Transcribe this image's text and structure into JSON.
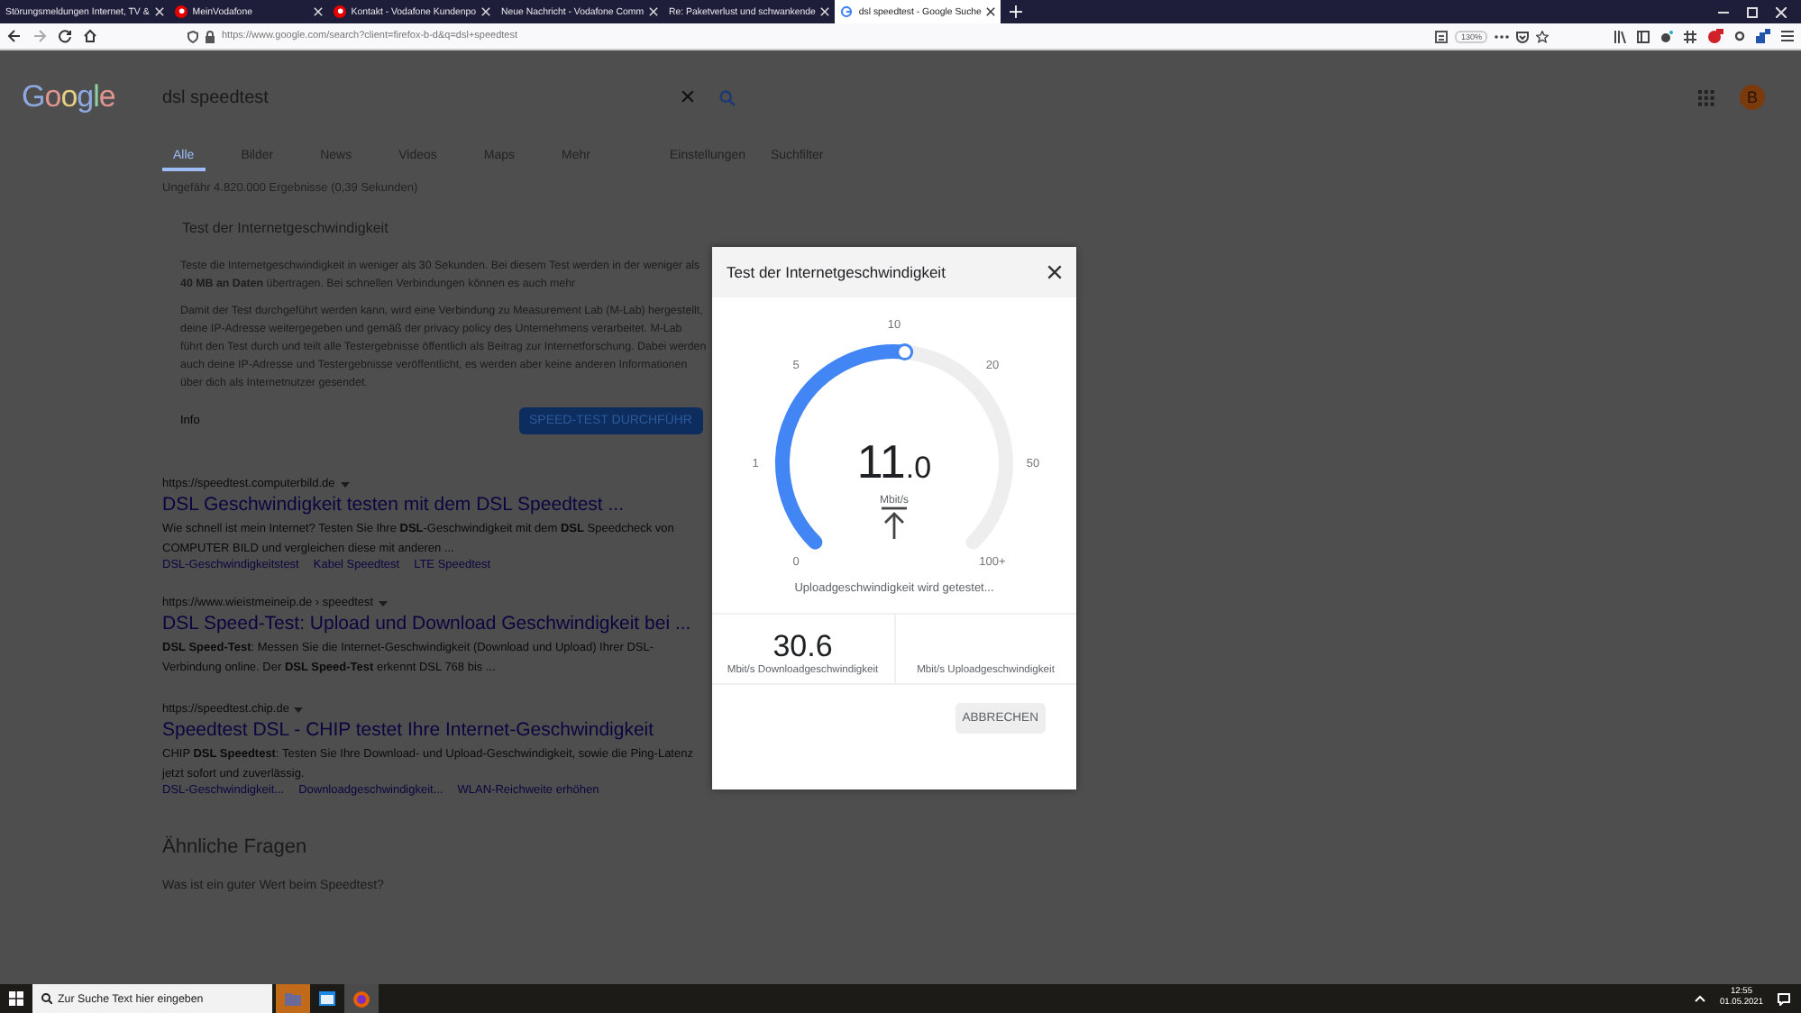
{
  "browser": {
    "tabs": [
      {
        "title": "Störungsmeldungen Internet, TV &",
        "kind": "plain",
        "selected": false
      },
      {
        "title": "MeinVodafone",
        "kind": "vodafone",
        "selected": false
      },
      {
        "title": "Kontakt - Vodafone Kundenpo",
        "kind": "vodafone",
        "selected": false
      },
      {
        "title": "Neue Nachricht - Vodafone Comm",
        "kind": "plain",
        "selected": false
      },
      {
        "title": "Re: Paketverlust und schwankende",
        "kind": "plain",
        "selected": false
      },
      {
        "title": "dsl speedtest - Google Suche",
        "kind": "google",
        "selected": true
      }
    ],
    "url": "https://www.google.com/search?client=firefox-b-d&q=dsl+speedtest",
    "zoom": "130%"
  },
  "google": {
    "logo": "Google",
    "query": "dsl speedtest",
    "avatar": "B",
    "nav": [
      {
        "label": "Alle",
        "selected": true
      },
      {
        "label": "Bilder",
        "selected": false
      },
      {
        "label": "News",
        "selected": false
      },
      {
        "label": "Videos",
        "selected": false
      },
      {
        "label": "Maps",
        "selected": false
      },
      {
        "label": "Mehr",
        "selected": false
      }
    ],
    "tools": [
      "Einstellungen",
      "Suchfilter"
    ],
    "result_count": "Ungefähr 4.820.000 Ergebnisse (0,39 Sekunden)",
    "speed_card": {
      "title": "Test der Internetgeschwindigkeit",
      "paragraphs": [
        "Teste die Internetgeschwindigkeit in weniger als 30 Sekunden. Bei diesem Test werden in der weniger als **40 MB an Daten** übertragen. Bei schnellen Verbindungen können es auch mehr",
        "Damit der Test durchgeführt werden kann, wird eine Verbindung zu Measurement Lab (M-Lab) hergestellt, deine IP-Adresse weitergegeben und gemäß der privacy policy des Unternehmens verarbeitet. M-Lab führt den Test durch und teilt alle Testergebnisse öffentlich als Beitrag zur Internetforschung. Dabei werden auch deine IP-Adresse und Testergebnisse veröffentlicht, es werden aber keine anderen Informationen über dich als Internetnutzer gesendet."
      ],
      "info": "Info",
      "button": "SPEED-TEST DURCHFÜHR"
    },
    "results": [
      {
        "url": "https://speedtest.computerbild.de",
        "title": "DSL Geschwindigkeit testen mit dem DSL Speedtest ...",
        "snippet": "Wie schnell ist mein Internet? Testen Sie Ihre **DSL**-Geschwindigkeit mit dem **DSL** Speedcheck von COMPUTER BILD und vergleichen diese mit anderen ...",
        "sitelinks": [
          "DSL-Geschwindigkeitstest",
          "Kabel Speedtest",
          "LTE Speedtest"
        ]
      },
      {
        "url": "https://www.wieistmeineip.de › speedtest",
        "title": "DSL Speed-Test: Upload und Download Geschwindigkeit bei ...",
        "snippet": "**DSL Speed-Test**: Messen Sie die Internet-Geschwindigkeit (Download und Upload) Ihrer DSL-Verbindung online. Der **DSL Speed-Test** erkennt DSL 768 bis ..."
      },
      {
        "url": "https://speedtest.chip.de",
        "title": "Speedtest DSL - CHIP testet Ihre Internet-Geschwindigkeit",
        "snippet": "CHIP **DSL Speedtest**: Testen Sie Ihre Download- und Upload-Geschwindigkeit, sowie die Ping-Latenz jetzt sofort und zuverlässig.",
        "sitelinks": [
          "DSL-Geschwindigkeit...",
          "Downloadgeschwindigkeit...",
          "WLAN-Reichweite erhöhen"
        ]
      }
    ],
    "related_heading": "Ähnliche Fragen",
    "related_question": "Was ist ein guter Wert beim Speedtest?"
  },
  "dialog": {
    "title": "Test der Internetgeschwindigkeit",
    "ticks": [
      "0",
      "1",
      "5",
      "10",
      "20",
      "50",
      "100+"
    ],
    "level": 0.52,
    "value": "11",
    "decimal": ".0",
    "unit": "Mbit/s",
    "status": "Uploadgeschwindigkeit wird getestet...",
    "stats": [
      {
        "value": "30.6",
        "label": "Mbit/s Downloadgeschwindigkeit"
      },
      {
        "label": "Mbit/s Uploadgeschwindigkeit"
      }
    ],
    "cancel": "ABBRECHEN"
  },
  "taskbar": {
    "search_placeholder": "Zur Suche Text hier eingeben",
    "time": "12:55",
    "date": "01.05.2021"
  }
}
